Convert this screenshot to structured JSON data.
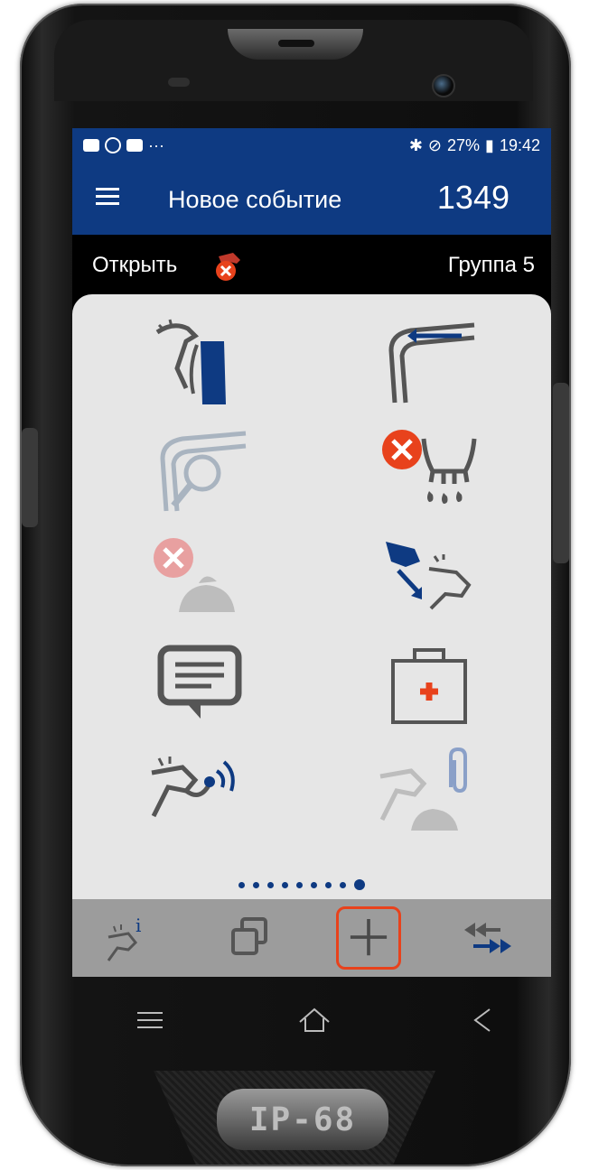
{
  "status_bar": {
    "battery": "27%",
    "time": "19:42",
    "icons": [
      "image-icon",
      "eh-icon",
      "youtube-icon",
      "more-dots-icon",
      "bluetooth-icon",
      "dnd-icon",
      "battery-icon"
    ],
    "more": "···"
  },
  "app_bar": {
    "title": "Новое событие",
    "number": "1349"
  },
  "sub_bar": {
    "open_label": "Открыть",
    "group_label": "Группа 5"
  },
  "grid": {
    "tiles": [
      "insemination-icon",
      "pregnancy-check-icon",
      "examination-icon",
      "dry-off-icon",
      "remove-calf-icon",
      "move-animal-icon",
      "note-icon",
      "health-treatment-icon",
      "rfid-tag-icon",
      "attachment-icon"
    ],
    "pages": 9,
    "active_page": 9
  },
  "bottom_bar": {
    "buttons": [
      "animal-info-icon",
      "copy-icon",
      "add-icon",
      "transfer-icon"
    ]
  },
  "nav": {
    "buttons": [
      "menu-icon",
      "home-icon",
      "back-icon"
    ]
  },
  "device": {
    "badge": "IP-68"
  },
  "colors": {
    "primary": "#0e3a82",
    "accent": "#e8421c",
    "icon_gray": "#555555",
    "disabled": "#a9b4c0"
  }
}
